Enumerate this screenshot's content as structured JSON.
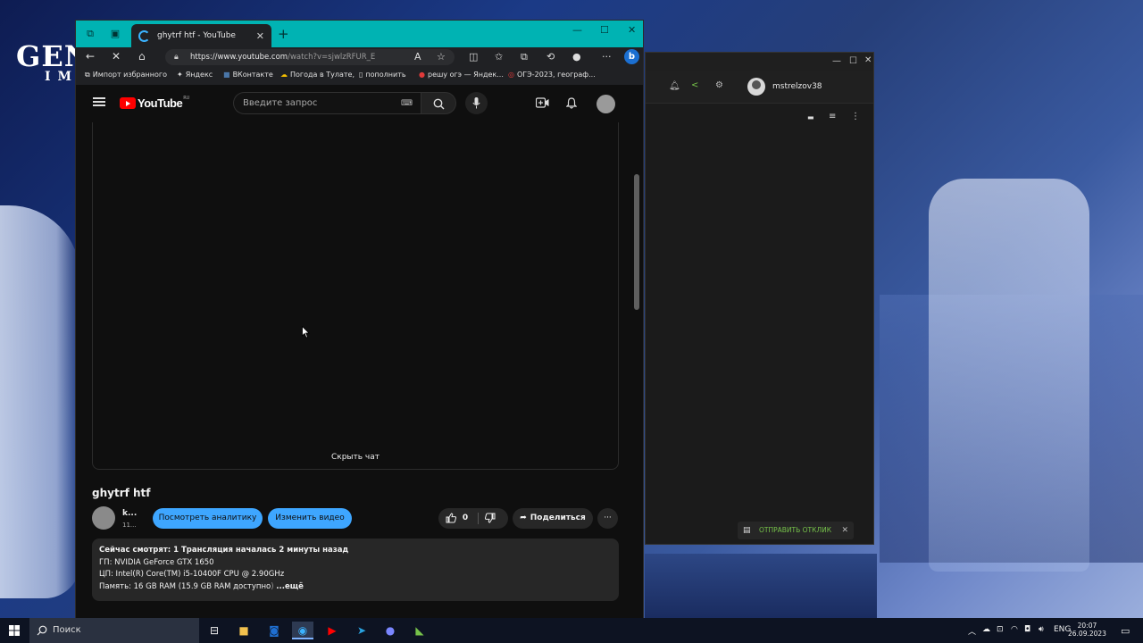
{
  "desktop": {
    "logo_main": "GEN",
    "logo_sub": "IM"
  },
  "browser": {
    "tab_title": "ghytrf htf - YouTube",
    "url_host": "https://www.youtube.com",
    "url_path": "/watch?v=sjwlzRFUR_E",
    "favorites": [
      {
        "label": "Импорт избранного"
      },
      {
        "label": "Яндекс"
      },
      {
        "label": "ВКонтакте"
      },
      {
        "label": "Погода в Тулате,"
      },
      {
        "label": "пополнить"
      },
      {
        "label": "решу огэ — Яндек..."
      },
      {
        "label": "ОГЭ-2023, географ..."
      }
    ]
  },
  "youtube": {
    "logo_text": "YouTube",
    "logo_region": "RU",
    "search_placeholder": "Введите запрос",
    "hide_chat": "Скрыть чат",
    "video_title": "ghytrf htf",
    "channel_name": "k...",
    "channel_subs": "11...",
    "analytics_button": "Посмотреть аналитику",
    "edit_button": "Изменить видео",
    "like_count": "0",
    "share_button": "Поделиться",
    "description": {
      "line1": "Сейчас смотрят: 1  Трансляция началась 2 минуты назад",
      "line2": "ГП: NVIDIA GeForce GTX 1650",
      "line3": "ЦП: Intel(R) Core(TM) i5-10400F CPU @ 2.90GHz",
      "line4": "Память: 16 GB RAM (15.9 GB RAM доступно",
      "line4_fade": ")",
      "more": "...ещё"
    }
  },
  "panel": {
    "username": "mstrelzov38",
    "feedback": "ОТПРАВИТЬ ОТКЛИК"
  },
  "taskbar": {
    "search_label": "Поиск",
    "lang": "ENG",
    "time": "20:07",
    "date": "26.09.2023"
  },
  "colors": {
    "titlebar": "#00b3b3",
    "yt_red": "#ff0000",
    "yt_blue": "#3ea6ff",
    "feedback_green": "#76c24a"
  }
}
